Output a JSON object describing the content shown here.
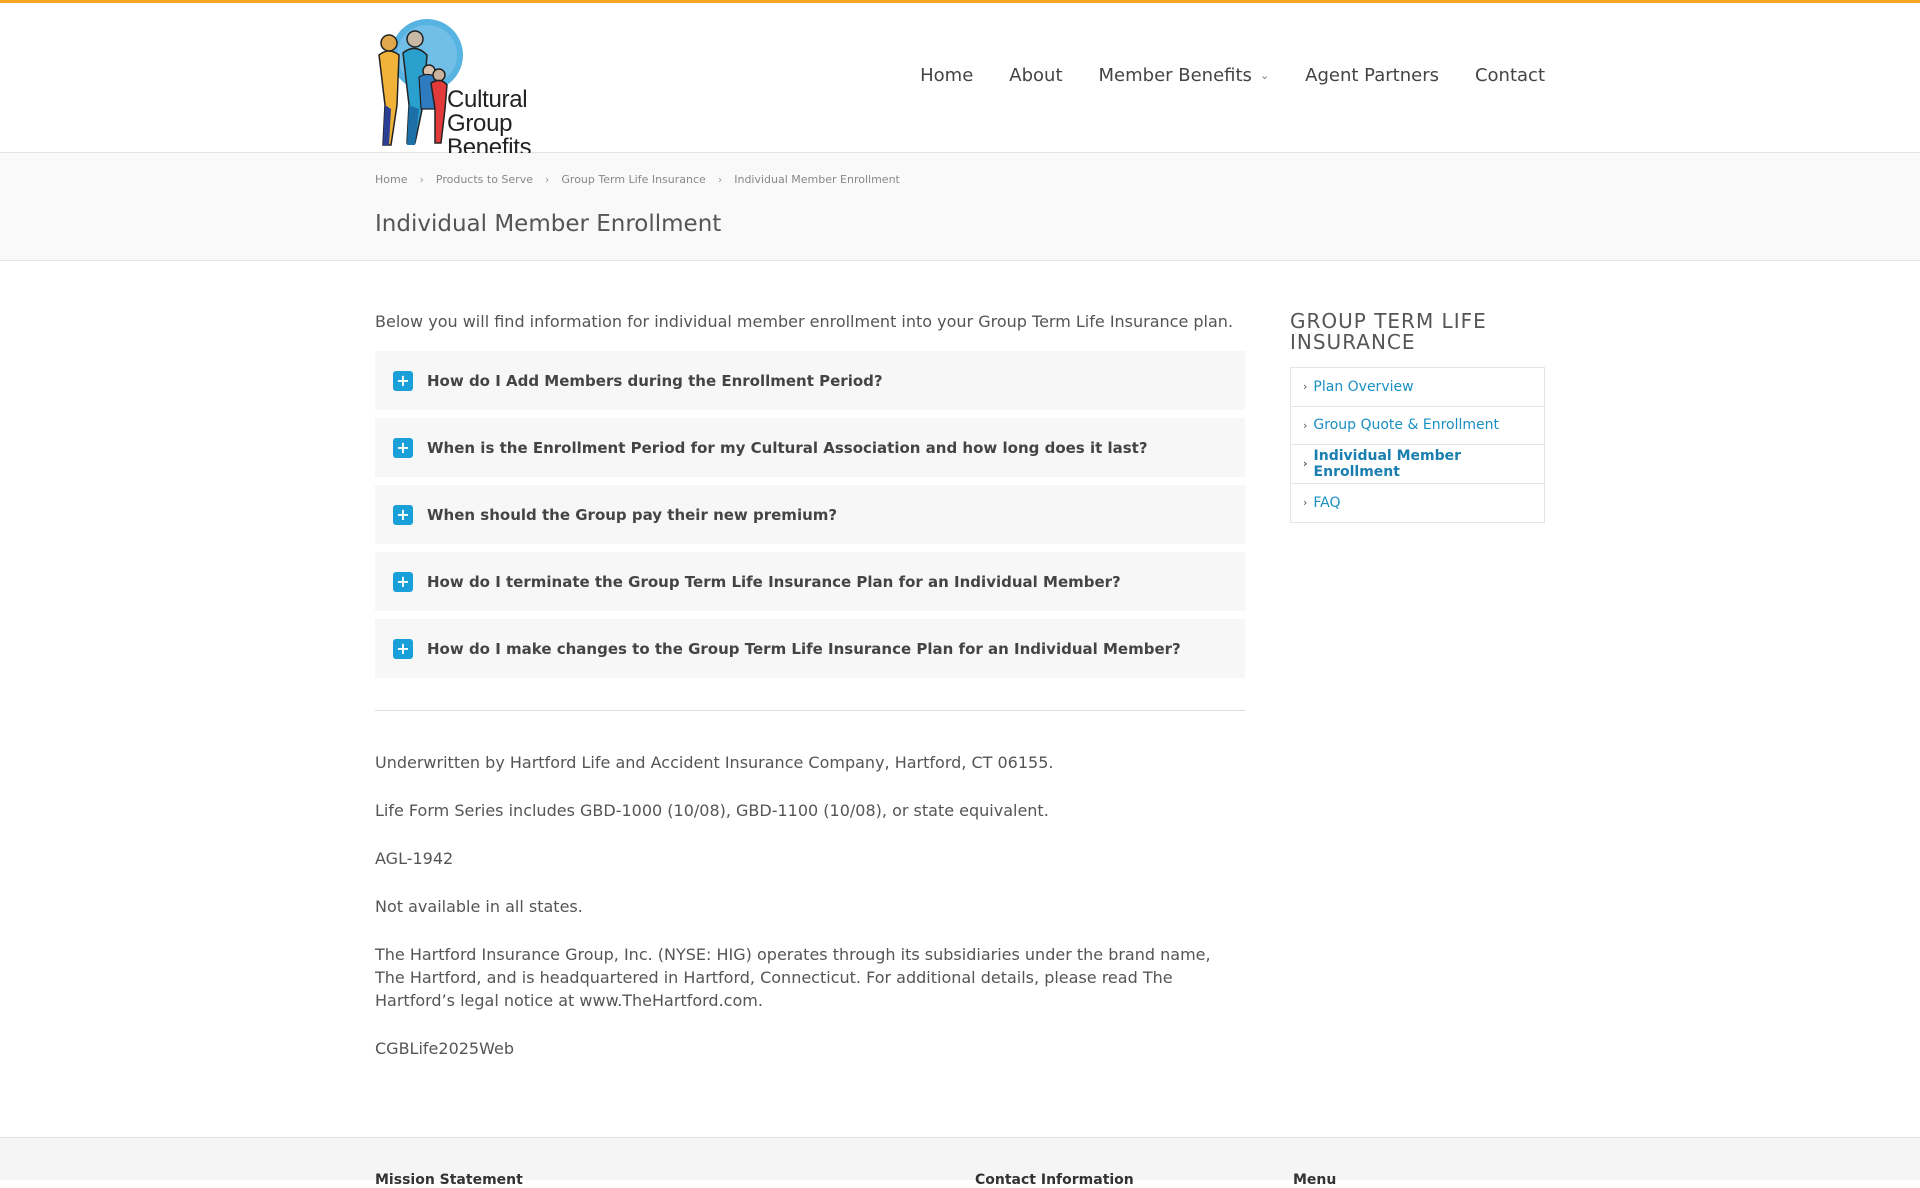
{
  "brand": {
    "name_line1": "Cultural Group",
    "name_line2": "Benefits"
  },
  "nav": {
    "home": "Home",
    "about": "About",
    "member_benefits": "Member Benefits",
    "agent_partners": "Agent Partners",
    "contact": "Contact"
  },
  "breadcrumb": [
    "Home",
    "Products to Serve",
    "Group Term Life Insurance",
    "Individual Member Enrollment"
  ],
  "page_title": "Individual Member Enrollment",
  "intro": "Below you will find information for individual member enrollment into your Group Term Life Insurance plan.",
  "faqs": [
    "How do I Add Members during the Enrollment Period?",
    "When is the Enrollment Period for my Cultural Association and how long does it last?",
    "When should the Group pay their new premium?",
    "How do I terminate the Group Term Life Insurance Plan for an Individual Member?",
    "How do I make changes to the Group Term Life Insurance Plan for an Individual Member?"
  ],
  "disclosures": [
    "Underwritten by Hartford Life and Accident Insurance Company, Hartford, CT 06155.",
    "Life Form Series includes GBD-1000 (10/08), GBD-1100 (10/08), or state equivalent.",
    "AGL-1942",
    "Not available in all states.",
    "The Hartford Insurance Group, Inc. (NYSE: HIG) operates through its subsidiaries under the brand name, The Hartford, and is headquartered in Hartford, Connecticut. For additional details, please read The Hartford’s legal notice at www.TheHartford.com.",
    "CGBLife2025Web"
  ],
  "sidebar": {
    "title": "Group Term Life Insurance",
    "items": [
      "Plan Overview",
      "Group Quote & Enrollment",
      "Individual Member Enrollment",
      "FAQ"
    ],
    "active_index": 2
  },
  "footer": {
    "col1": "Mission Statement",
    "col2": "Contact Information",
    "col3": "Menu"
  },
  "colors": {
    "accent": "#1aa0d8",
    "topbar": "#f5a623",
    "link": "#1a8fc1"
  }
}
